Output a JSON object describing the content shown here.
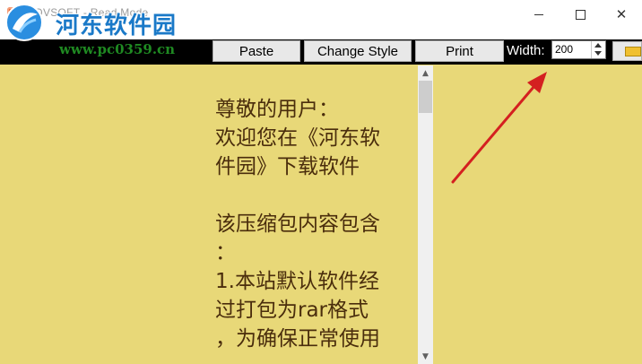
{
  "window": {
    "title": "VOVSOFT - Read Mode",
    "minimize_glyph": "",
    "close_glyph": "✕"
  },
  "watermark": {
    "site_name": "河东软件园",
    "url": "www.pc0359.cn"
  },
  "toolbar": {
    "paste_label": "Paste",
    "change_style_label": "Change Style",
    "print_label": "Print",
    "width_label": "Width:",
    "width_value": "200"
  },
  "reader": {
    "lines": [
      "尊敬的用户：",
      "欢迎您在《河东软",
      "件园》下载软件",
      "",
      "该压缩包内容包含",
      "：",
      "1.本站默认软件经",
      "过打包为rar格式",
      "，为确保正常使用"
    ]
  },
  "colors": {
    "content_background": "#e8d878",
    "reader_text": "#4a2d0c",
    "toolbar_background": "#000000",
    "annotation_arrow": "#d42020"
  }
}
